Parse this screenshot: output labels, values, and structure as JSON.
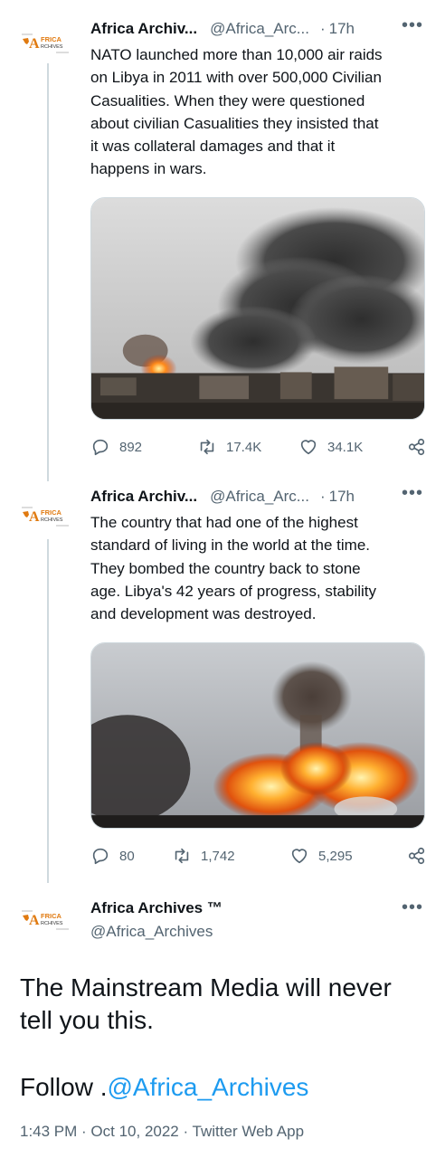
{
  "tweet1": {
    "author_name": "Africa Archiv...",
    "handle": "@Africa_Arc...",
    "separator": "·",
    "time": "17h",
    "more": "•••",
    "lines": [
      "NATO launched more than 10,000 air raids",
      "on Libya in 2011 with over 500,000 Civilian",
      "Casualities. When they were questioned",
      "about civilian Casualities they insisted that",
      "it was collateral damages and that it",
      "happens in wars."
    ],
    "replies": "892",
    "retweets": "17.4K",
    "likes": "34.1K"
  },
  "tweet2": {
    "author_name": "Africa Archiv...",
    "handle": "@Africa_Arc...",
    "separator": "·",
    "time": "17h",
    "more": "•••",
    "lines": [
      "The country that had one of the highest",
      "standard of living in the world at the time.",
      "They bombed the country back to stone",
      "age. Libya's 42 years of progress, stability",
      "and development was destroyed."
    ],
    "replies": "80",
    "retweets": "1,742",
    "likes": "5,295"
  },
  "main_tweet": {
    "author_name": "Africa Archives ™",
    "handle": "@Africa_Archives",
    "more": "•••",
    "line1": "The Mainstream Media will never",
    "line2": "tell you this.",
    "follow_prefix": "Follow .",
    "follow_mention": "@Africa_Archives",
    "timestamp": "1:43 PM · Oct 10, 2022 · Twitter Web App"
  },
  "avatar_logo": {
    "brand_a": "A",
    "brand_top": "FRICA",
    "brand_bottom": "RCHIVES"
  },
  "icons": {
    "reply": "reply-icon",
    "retweet": "retweet-icon",
    "like": "heart-icon",
    "share": "share-icon",
    "more": "more-icon"
  },
  "colors": {
    "text": "#0f1419",
    "secondary": "#536471",
    "accent": "#1d9bf0",
    "thread_line": "#cfd9de",
    "logo_orange": "#e07a10"
  }
}
